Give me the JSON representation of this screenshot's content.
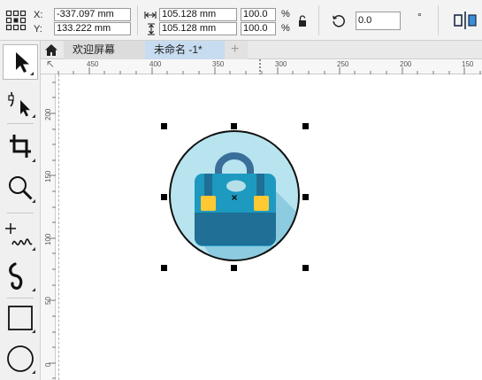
{
  "property_bar": {
    "x_label": "X:",
    "y_label": "Y:",
    "x_value": "-337.097 mm",
    "y_value": "133.222 mm",
    "width_value": "105.128 mm",
    "height_value": "105.128 mm",
    "scale_x": "100.0",
    "scale_y": "100.0",
    "percent_symbol": "%",
    "rotation_value": "0.0"
  },
  "tabs": [
    {
      "label": "欢迎屏幕"
    },
    {
      "label": "未命名 -1*"
    }
  ],
  "new_tab_label": "+",
  "ruler": {
    "top": [
      "450",
      "400",
      "350",
      "300",
      "250",
      "200",
      "150"
    ],
    "left": [
      "200",
      "150",
      "100",
      "50",
      "0"
    ]
  },
  "icons": {
    "object_origin": "object-origin-icon",
    "lock_ratio": "lock-ratio-icon",
    "rotate": "rotate-icon",
    "home": "home-icon",
    "pick_tool": "pick-tool-icon",
    "shape_tool": "shape-tool-icon",
    "crop_tool": "crop-tool-icon",
    "zoom_tool": "zoom-tool-icon",
    "freehand_tool": "freehand-tool-icon",
    "artistic_media_tool": "artistic-media-tool-icon",
    "rectangle_tool": "rectangle-tool-icon",
    "ellipse_tool": "ellipse-tool-icon"
  },
  "colors": {
    "icon_circle_fill": "#b7e4ef",
    "bag_body": "#1e9ac0",
    "bag_dark": "#1f6f96",
    "bag_shadow": "#8ccbe0",
    "buckles": "#ffc933",
    "handle": "#3a6f9a",
    "tab_active": "#c7dcf0"
  }
}
